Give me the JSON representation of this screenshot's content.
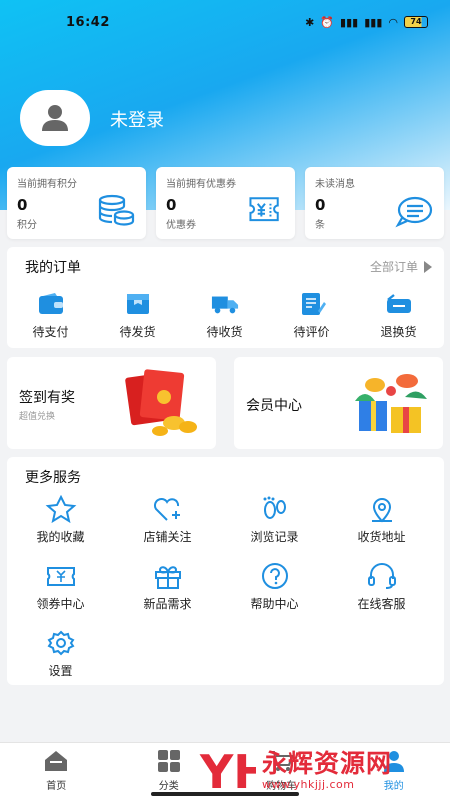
{
  "status_bar": {
    "time": "16:42",
    "battery": "74",
    "icons": [
      "bluetooth-icon",
      "alarm-icon",
      "signal-icon",
      "signal-icon",
      "wifi-icon",
      "battery-icon"
    ]
  },
  "profile": {
    "username": "未登录",
    "avatar_icon": "user-icon"
  },
  "stats": [
    {
      "title": "当前拥有积分",
      "value": "0",
      "unit": "积分",
      "icon": "coins-icon"
    },
    {
      "title": "当前拥有优惠券",
      "value": "0",
      "unit": "优惠券",
      "icon": "coupon-icon"
    },
    {
      "title": "未读消息",
      "value": "0",
      "unit": "条",
      "icon": "message-icon"
    }
  ],
  "orders": {
    "title": "我的订单",
    "all_label": "全部订单",
    "items": [
      {
        "label": "待支付",
        "icon": "wallet-icon"
      },
      {
        "label": "待发货",
        "icon": "box-icon"
      },
      {
        "label": "待收货",
        "icon": "truck-icon"
      },
      {
        "label": "待评价",
        "icon": "review-icon"
      },
      {
        "label": "退换货",
        "icon": "return-icon"
      }
    ]
  },
  "promos": [
    {
      "title": "签到有奖",
      "subtitle": "超值兑换",
      "icon": "red-envelope-icon"
    },
    {
      "title": "会员中心",
      "subtitle": "",
      "icon": "gift-box-icon"
    }
  ],
  "services": {
    "title": "更多服务",
    "items": [
      {
        "label": "我的收藏",
        "icon": "star-icon"
      },
      {
        "label": "店铺关注",
        "icon": "heart-plus-icon"
      },
      {
        "label": "浏览记录",
        "icon": "footprint-icon"
      },
      {
        "label": "收货地址",
        "icon": "location-icon"
      },
      {
        "label": "领券中心",
        "icon": "ticket-icon"
      },
      {
        "label": "新品需求",
        "icon": "gift-icon"
      },
      {
        "label": "帮助中心",
        "icon": "help-icon"
      },
      {
        "label": "在线客服",
        "icon": "headset-icon"
      },
      {
        "label": "设置",
        "icon": "settings-icon"
      }
    ]
  },
  "tabbar": [
    {
      "label": "首页",
      "icon": "home-icon"
    },
    {
      "label": "分类",
      "icon": "grid-icon"
    },
    {
      "label": "购物车",
      "icon": "cart-icon"
    },
    {
      "label": "我的",
      "icon": "user-icon"
    }
  ],
  "watermark": {
    "text": "永辉资源网",
    "url": "www.yhkjjj.com",
    "logo_text": "YH"
  },
  "colors": {
    "accent": "#1f8fe0",
    "header_top": "#0fc2f4",
    "watermark": "#e32b3a"
  }
}
